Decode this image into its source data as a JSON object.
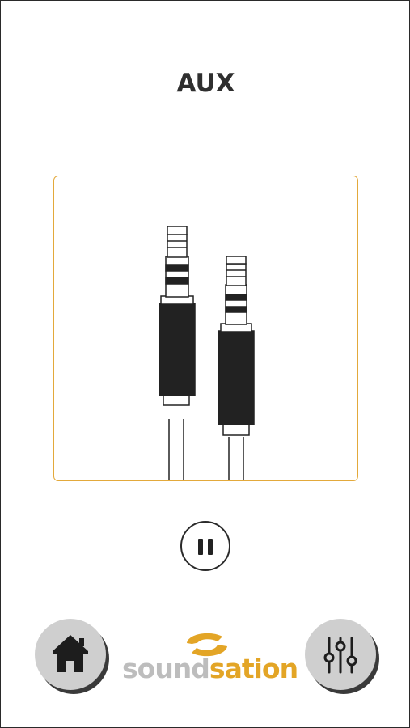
{
  "screen": {
    "title": "AUX",
    "accent_color": "#e3a93b"
  },
  "media": {
    "illustration": "aux-cable-jacks-icon"
  },
  "playback": {
    "state_icon": "pause-icon"
  },
  "nav": {
    "home_icon": "home-icon",
    "equalizer_icon": "equalizer-icon"
  },
  "brand": {
    "part1": "sound",
    "part2": "sation",
    "color_gray": "#bdbdbd",
    "color_orange": "#e3a526"
  }
}
